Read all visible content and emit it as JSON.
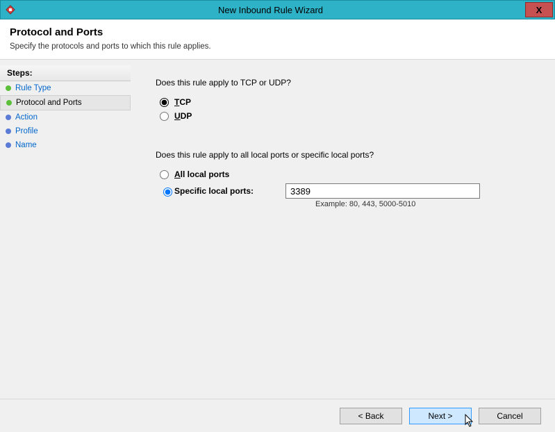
{
  "window": {
    "title": "New Inbound Rule Wizard",
    "close_symbol": "X"
  },
  "header": {
    "title": "Protocol and Ports",
    "subtitle": "Specify the protocols and ports to which this rule applies."
  },
  "sidebar": {
    "heading": "Steps:",
    "items": [
      {
        "label": "Rule Type",
        "bullet": "green",
        "current": false
      },
      {
        "label": "Protocol and Ports",
        "bullet": "green",
        "current": true
      },
      {
        "label": "Action",
        "bullet": "blue",
        "current": false
      },
      {
        "label": "Profile",
        "bullet": "blue",
        "current": false
      },
      {
        "label": "Name",
        "bullet": "blue",
        "current": false
      }
    ]
  },
  "main": {
    "protocol_question": "Does this rule apply to TCP or UDP?",
    "protocol_options": {
      "tcp": {
        "label_pre": "",
        "label_ul": "T",
        "label_post": "CP",
        "checked": true
      },
      "udp": {
        "label_pre": "",
        "label_ul": "U",
        "label_post": "DP",
        "checked": false
      }
    },
    "ports_question": "Does this rule apply to all local ports or specific local ports?",
    "ports_options": {
      "all": {
        "label_pre": "",
        "label_ul": "A",
        "label_post": "ll local ports",
        "checked": false
      },
      "specific": {
        "label_pre": "",
        "label_ul": "S",
        "label_post": "pecific local ports:",
        "checked": true
      }
    },
    "ports_value": "3389",
    "ports_example": "Example: 80, 443, 5000-5010"
  },
  "buttons": {
    "back": "< Back",
    "next": "Next >",
    "cancel": "Cancel"
  }
}
